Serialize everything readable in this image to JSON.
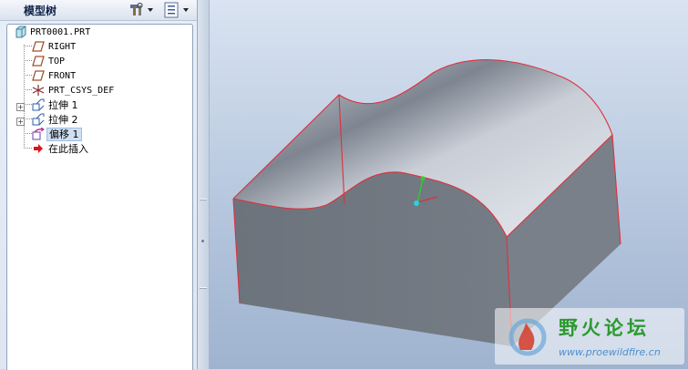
{
  "panel": {
    "title": "模型树",
    "settings_icon": "tools-icon",
    "show_icon": "list-icon"
  },
  "tree": {
    "items": [
      {
        "label": "PRT0001.PRT",
        "icon": "part-icon"
      },
      {
        "label": "RIGHT",
        "icon": "datum-plane-icon"
      },
      {
        "label": "TOP",
        "icon": "datum-plane-icon"
      },
      {
        "label": "FRONT",
        "icon": "datum-plane-icon"
      },
      {
        "label": "PRT_CSYS_DEF",
        "icon": "csys-icon"
      },
      {
        "label": "拉伸 1",
        "icon": "extrude-icon"
      },
      {
        "label": "拉伸 2",
        "icon": "extrude-icon"
      },
      {
        "label": "偏移 1",
        "icon": "offset-icon",
        "selected": true
      },
      {
        "label": "在此插入",
        "icon": "insert-here-arrow-icon"
      }
    ]
  },
  "watermark": {
    "title": "野火论坛",
    "url": "www.proewildfire.cn"
  },
  "colors": {
    "edge": "#e0303c",
    "side_face": "#6f757d",
    "top_face_light": "#dfe3ea",
    "selection": "#cfe0f3"
  }
}
